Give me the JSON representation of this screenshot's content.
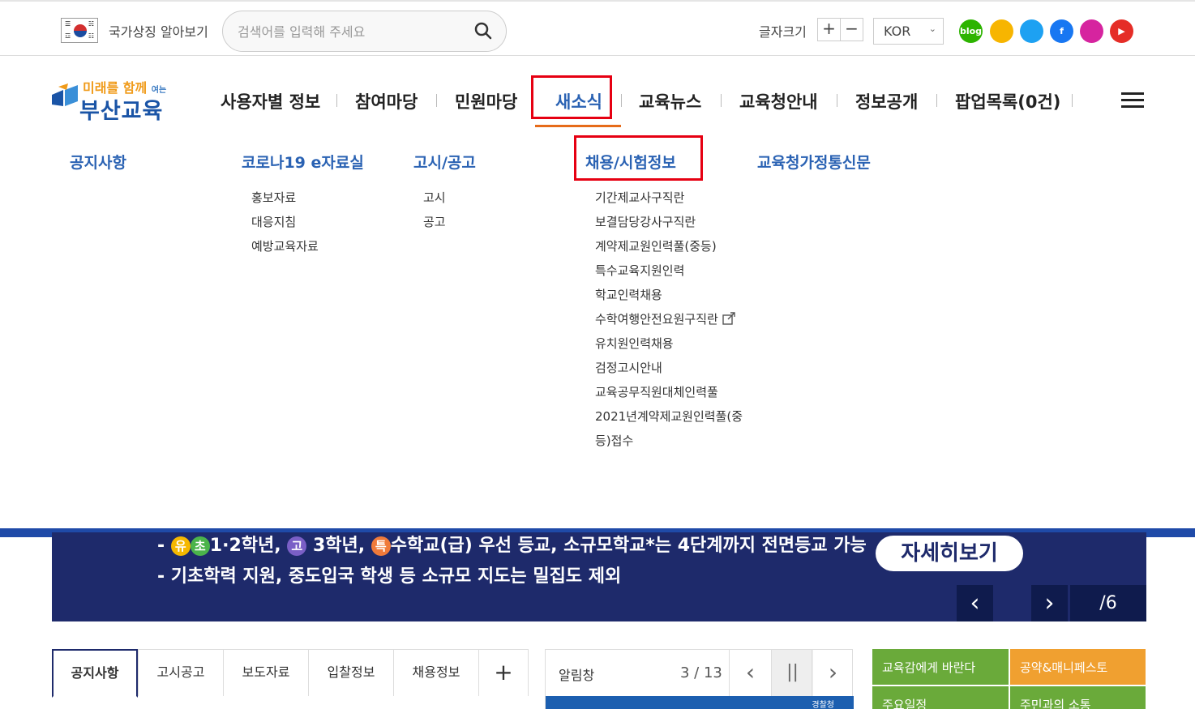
{
  "topbar": {
    "symbol_text": "국가상징 알아보기",
    "search_placeholder": "검색어를 입력해 주세요",
    "fontsize_label": "글자크기",
    "plus": "+",
    "minus": "−",
    "lang": "KOR",
    "social": [
      {
        "name": "blog",
        "label": "blog",
        "color": "#2db400"
      },
      {
        "name": "kakaostory",
        "label": "",
        "color": "#f7b500"
      },
      {
        "name": "twitter",
        "label": "",
        "color": "#1da1f2"
      },
      {
        "name": "facebook",
        "label": "f",
        "color": "#1877f2"
      },
      {
        "name": "instagram",
        "label": "",
        "color": "#d6249f"
      },
      {
        "name": "youtube",
        "label": "▶",
        "color": "#e52d27"
      }
    ]
  },
  "logo": {
    "line1_a": "미래를 함께",
    "line1_b": "여는",
    "line2": "부산교육"
  },
  "gnb": [
    "사용자별 정보",
    "참여마당",
    "민원마당",
    "새소식",
    "교육뉴스",
    "교육청안내",
    "정보공개",
    "팝업목록(0건)"
  ],
  "submenu": {
    "col1": {
      "head": "공지사항",
      "items": []
    },
    "col2": {
      "head": "코로나19 e자료실",
      "items": [
        "홍보자료",
        "대응지침",
        "예방교육자료"
      ]
    },
    "col3": {
      "head": "고시/공고",
      "items": [
        "고시",
        "공고"
      ]
    },
    "col4": {
      "head": "채용/시험정보",
      "items": [
        "기간제교사구직란",
        "보결담당강사구직란",
        "계약제교원인력풀(중등)",
        "특수교육지원인력",
        "학교인력채용",
        "수학여행안전요원구직란",
        "유치원인력채용",
        "검정고시안내",
        "교육공무직원대체인력풀",
        "2021년계약제교원인력풀(중",
        "등)접수"
      ]
    },
    "col5": {
      "head": "교육청가정통신문",
      "items": []
    }
  },
  "banner": {
    "line1_prefix": "- ",
    "chip1": "유",
    "chip2": "초",
    "line1_a": "1·2학년, ",
    "chip3": "고",
    "line1_b": " 3학년, ",
    "chip4": "특",
    "line1_c": "수학교(급) 우선 등교, 소규모학교*는 4단계까지 전면등교 가능",
    "line2": "- 기초학력 지원, 중도입국 학생 등 소규모 지도는 밀집도 제외",
    "detail": "자세히보기",
    "prev": "‹",
    "next": "›",
    "page": "/6"
  },
  "tabs": [
    "공지사항",
    "고시공고",
    "보도자료",
    "입찰정보",
    "채용정보",
    "+"
  ],
  "alert": {
    "title": "알림창",
    "count": "3 / 13",
    "prev": "‹",
    "pause": "||",
    "next": "›",
    "strip": "경찰청"
  },
  "quick": [
    {
      "label": "교육감에게 바란다",
      "color": "#6aaa3a"
    },
    {
      "label": "공약&매니페스토",
      "color": "#f0a030"
    },
    {
      "label": "주요일정",
      "color": "#6aaa3a"
    },
    {
      "label": "주민과의 소통",
      "color": "#6aaa3a"
    }
  ]
}
